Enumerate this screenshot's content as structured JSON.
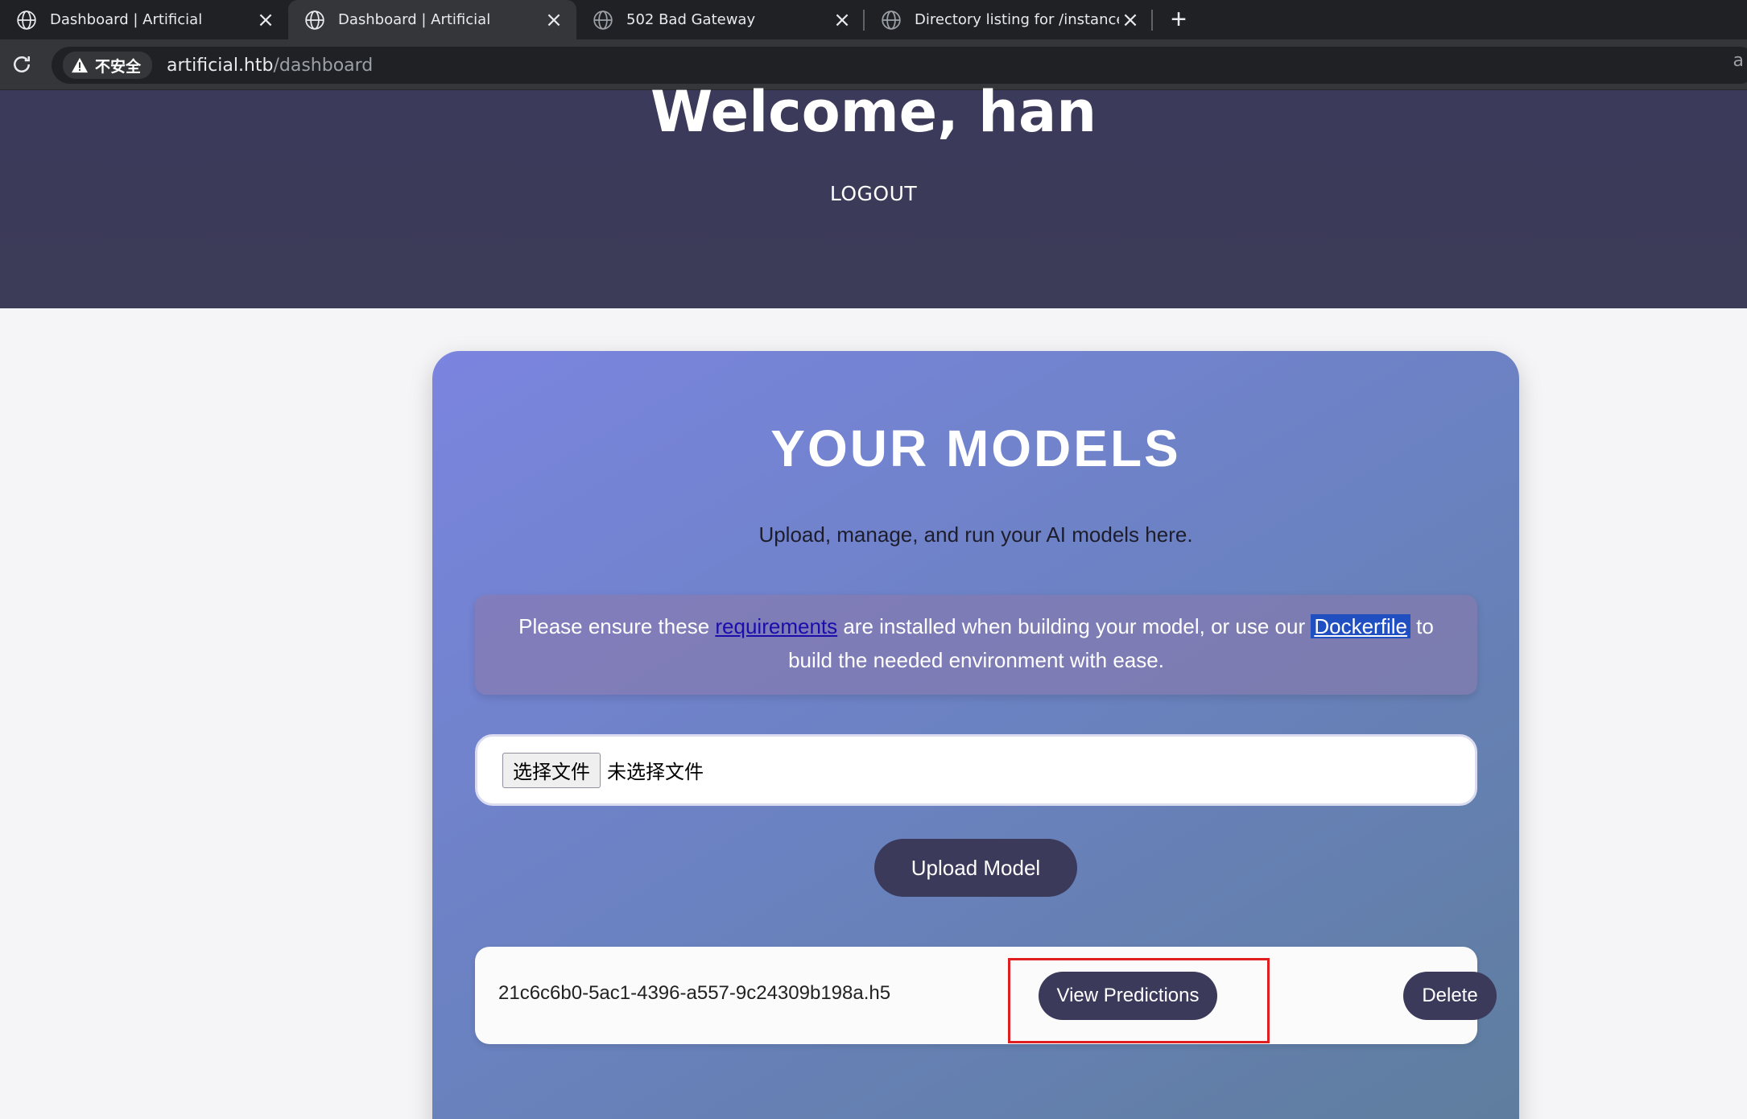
{
  "browser": {
    "tabs": [
      {
        "title": "Dashboard | Artificial",
        "active": false
      },
      {
        "title": "Dashboard | Artificial",
        "active": true
      },
      {
        "title": "502 Bad Gateway",
        "active": false
      },
      {
        "title": "Directory listing for /instance/",
        "active": false
      }
    ],
    "security_label": "不安全",
    "url_host": "artificial.htb",
    "url_path": "/dashboard",
    "edge_char": "a"
  },
  "header": {
    "welcome": "Welcome, han",
    "logout": "LOGOUT"
  },
  "models": {
    "title": "YOUR MODELS",
    "subtitle": "Upload, manage, and run your AI models here.",
    "notice": {
      "before": "Please ensure these ",
      "link1": "requirements",
      "middle": " are installed when building your model, or use our ",
      "link2": "Dockerfile",
      "after": " to build the needed environment with ease."
    },
    "file_button": "选择文件",
    "file_status": "未选择文件",
    "upload_button": "Upload Model",
    "list": [
      {
        "name": "21c6c6b0-5ac1-4396-a557-9c24309b198a.h5",
        "view_label": "View Predictions",
        "delete_label": "Delete"
      }
    ]
  },
  "colors": {
    "header_bg": "#3b3a5a",
    "button_bg": "#3b3a5a",
    "highlight": "#e02020"
  }
}
